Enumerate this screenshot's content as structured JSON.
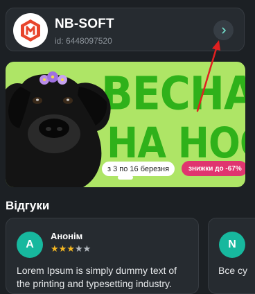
{
  "shop": {
    "name": "NB-SOFT",
    "id_text": "id: 6448097520",
    "logo_icon": "nb-soft-logo-icon",
    "open_icon": "chevron-right-icon"
  },
  "banner": {
    "headline_line1": "ВЕСНА",
    "headline_line2": "НА НОСІ",
    "dates": "з 3 по 16 березня",
    "discount": "знижки до -67%",
    "accent_green": "#2fb11a",
    "background": "#aee566",
    "discount_color": "#e0356f"
  },
  "reviews": {
    "title": "Відгуки",
    "items": [
      {
        "initial": "A",
        "name": "Анонім",
        "rating": 3,
        "max_rating": 5,
        "text": "Lorem Ipsum is simply dummy text of the printing and typesetting industry."
      },
      {
        "initial": "N",
        "text": "Все су"
      }
    ]
  },
  "colors": {
    "page_bg": "#1c2024",
    "card_bg": "#262b30",
    "avatar_bg": "#17b89e",
    "star": "#f6b822",
    "annotation_arrow": "#e02020"
  }
}
